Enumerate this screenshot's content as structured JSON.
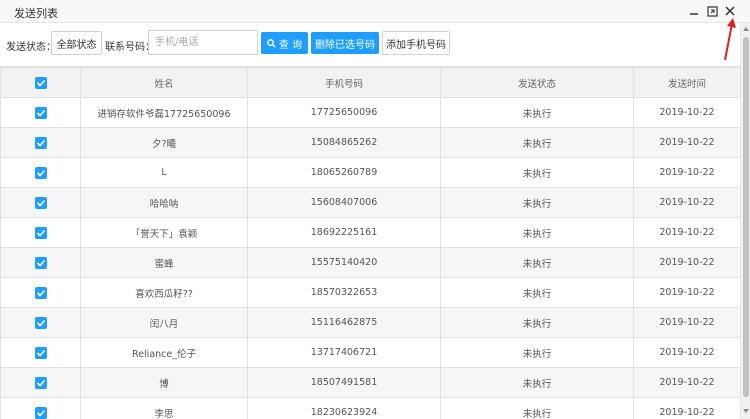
{
  "window": {
    "title": "发送列表"
  },
  "toolbar": {
    "status_label": "发送状态：",
    "status_select_value": "全部状态",
    "contact_label": "联系号码：",
    "contact_placeholder": "手机/电话",
    "search_label": "查 询",
    "delete_label": "删除已选号码",
    "add_label": "添加手机号码"
  },
  "table": {
    "columns": [
      "姓名",
      "手机号码",
      "发送状态",
      "发送时间"
    ],
    "rows": [
      {
        "name": "进销存软件爷磊17725650096",
        "phone": "17725650096",
        "status": "未执行",
        "time": "2019-10-22"
      },
      {
        "name": "夕?曦",
        "phone": "15084865262",
        "status": "未执行",
        "time": "2019-10-22"
      },
      {
        "name": "L",
        "phone": "18065260789",
        "status": "未执行",
        "time": "2019-10-22"
      },
      {
        "name": "哈哈呐",
        "phone": "15608407006",
        "status": "未执行",
        "time": "2019-10-22"
      },
      {
        "name": "「誉天下」袁颖",
        "phone": "18692225161",
        "status": "未执行",
        "time": "2019-10-22"
      },
      {
        "name": "蜜蜂",
        "phone": "15575140420",
        "status": "未执行",
        "time": "2019-10-22"
      },
      {
        "name": "喜欢西瓜籽??",
        "phone": "18570322653",
        "status": "未执行",
        "time": "2019-10-22"
      },
      {
        "name": "闰八月",
        "phone": "15116462875",
        "status": "未执行",
        "time": "2019-10-22"
      },
      {
        "name": "Reliance_伦子",
        "phone": "13717406721",
        "status": "未执行",
        "time": "2019-10-22"
      },
      {
        "name": "博",
        "phone": "18507491581",
        "status": "未执行",
        "time": "2019-10-22"
      },
      {
        "name": "李思",
        "phone": "18230623924",
        "status": "未执行",
        "time": "2019-10-22"
      }
    ]
  },
  "colors": {
    "accent": "#1e9fff",
    "annotation": "#e02020"
  }
}
